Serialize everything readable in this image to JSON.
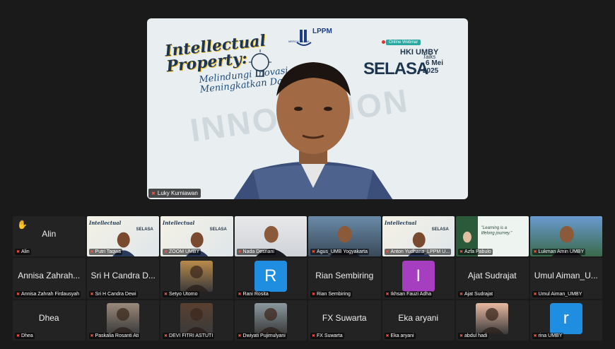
{
  "speaker": {
    "name": "Luky Kurniawan",
    "banner": {
      "title_line1": "Intellectual",
      "title_line2": "Property:",
      "subtitle_line1": "Melindungi Inovasi",
      "subtitle_line2": "Meningkatkan Daya",
      "org": "LPPM",
      "org_sub": "MERCU BUANA",
      "webinar_label": "Online Webinar",
      "series": "HKI UMBY",
      "series_word": "Talks",
      "day": "SELASA",
      "date_top": "6 Mei",
      "date_bottom": "2025",
      "background_word": "INNOVATION"
    }
  },
  "gallery": {
    "tiles": [
      {
        "label": "Alin",
        "center": "Alin",
        "kind": "name",
        "hand": true
      },
      {
        "label": "Putri Taqwa",
        "kind": "banner-video"
      },
      {
        "label": "ZOOM UMBY",
        "kind": "banner-video"
      },
      {
        "label": "Nada Desriani",
        "kind": "video-woman"
      },
      {
        "label": "Agus_UMB Yogyakarta",
        "kind": "video-man"
      },
      {
        "label": "Anton Yudhana_LPPM U...",
        "kind": "banner-video-man"
      },
      {
        "label": "Azfa Pabulo",
        "kind": "quote-video",
        "quote": "\"Learning is a lifelong journey.\""
      },
      {
        "label": "Lukman Amin UMBY",
        "kind": "video-outdoor"
      },
      {
        "label": "Annisa Zahrah Firdausyah",
        "center": "Annisa Zahrah...",
        "kind": "name"
      },
      {
        "label": "Sri H Candra Dewi",
        "center": "Sri H Candra D...",
        "kind": "name"
      },
      {
        "label": "Setyo Utomo",
        "kind": "photo",
        "photo_color": "#b88a4a"
      },
      {
        "label": "Rani Rosita",
        "kind": "letter",
        "letter": "R",
        "color": "#1f8de0"
      },
      {
        "label": "Rian Sembiring",
        "center": "Rian Sembiring",
        "kind": "name"
      },
      {
        "label": "Ikhsan Fauzi Adha",
        "kind": "letter",
        "letter": "I",
        "color": "#a63fbf"
      },
      {
        "label": "Ajat Sudrajat",
        "center": "Ajat Sudrajat",
        "kind": "name"
      },
      {
        "label": "Umul Aiman_UMBY",
        "center": "Umul Aiman_U...",
        "kind": "name"
      },
      {
        "label": "Dhea",
        "center": "Dhea",
        "kind": "name"
      },
      {
        "label": "Paskalia Rosanti Ati",
        "kind": "photo",
        "photo_color": "#9a8a7a"
      },
      {
        "label": "DEVI FITRI ASTUTI",
        "kind": "photo",
        "photo_color": "#5a4030"
      },
      {
        "label": "Dwiyati Pujimulyani",
        "kind": "photo",
        "photo_color": "#8a9aa0"
      },
      {
        "label": "FX Suwarta",
        "center": "FX Suwarta",
        "kind": "name"
      },
      {
        "label": "Eka aryani",
        "center": "Eka aryani",
        "kind": "name"
      },
      {
        "label": "abdul hadi",
        "kind": "photo",
        "photo_color": "#e9b9a0"
      },
      {
        "label": "rina UMBY",
        "kind": "letter",
        "letter": "r",
        "color": "#1f8de0"
      }
    ]
  },
  "icons": {
    "mic_muted": "mic-muted-icon",
    "raised_hand": "raised-hand-icon"
  },
  "colors": {
    "background": "#1a1a1a",
    "tile": "#232323",
    "muted_mic": "#e54444"
  }
}
